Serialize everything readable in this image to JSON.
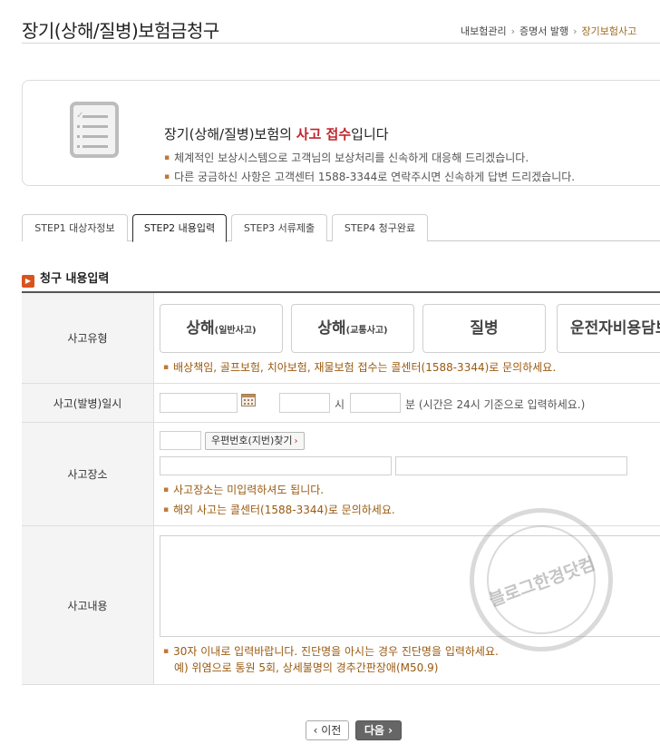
{
  "page": {
    "title": "장기(상해/질병)보험금청구",
    "breadcrumb": [
      "내보험관리",
      "증명서 발행",
      "장기보험사고"
    ]
  },
  "notice": {
    "heading_pre": "장기(상해/질병)보험의 ",
    "heading_highlight": "사고 접수",
    "heading_post": "입니다",
    "line1": "체계적인 보상시스템으로 고객님의 보상처리를 신속하게 대응해 드리겠습니다.",
    "line2": "다른 궁금하신 사항은 고객센터 1588-3344로 연락주시면 신속하게 답변 드리겠습니다."
  },
  "tabs": [
    {
      "label": "STEP1 대상자정보",
      "active": false
    },
    {
      "label": "STEP2 내용입력",
      "active": true
    },
    {
      "label": "STEP3 서류제출",
      "active": false
    },
    {
      "label": "STEP4 청구완료",
      "active": false
    }
  ],
  "section": {
    "title": "청구 내용입력"
  },
  "form": {
    "type": {
      "label": "사고유형",
      "options": [
        {
          "main": "상해",
          "sub": "(일반사고)"
        },
        {
          "main": "상해",
          "sub": "(교통사고)"
        },
        {
          "main": "질병",
          "sub": ""
        },
        {
          "main": "운전자비용담보",
          "sub": ""
        }
      ],
      "note": "배상책임, 골프보험, 치아보험, 재물보험 접수는 콜센터(1588-3344)로 문의하세요."
    },
    "datetime": {
      "label": "사고(발병)일시",
      "date_value": "",
      "hour_value": "",
      "hour_unit": "시",
      "minute_value": "",
      "minute_unit": "분 (시간은 24시 기준으로 입력하세요.)"
    },
    "location": {
      "label": "사고장소",
      "zipcode_value": "",
      "zipcode_button": "우편번호(지번)찾기",
      "address1_value": "",
      "address2_value": "",
      "note1": "사고장소는 미입력하셔도 됩니다.",
      "note2": "해외 사고는 콜센터(1588-3344)로 문의하세요."
    },
    "content": {
      "label": "사고내용",
      "value": "",
      "note1": "30자 이내로 입력바랍니다. 진단명을 아시는 경우 진단명을 입력하세요.",
      "note2": "예) 위염으로 통원 5회, 상세불명의 경추간판장애(M50.9)"
    }
  },
  "watermark": {
    "text": "블로그한경닷컴"
  },
  "buttons": {
    "prev": "‹ 이전",
    "next": "다음 ›"
  },
  "colors": {
    "accent": "#c0242c",
    "note": "#9a5a10",
    "section_icon": "#d9531e"
  }
}
